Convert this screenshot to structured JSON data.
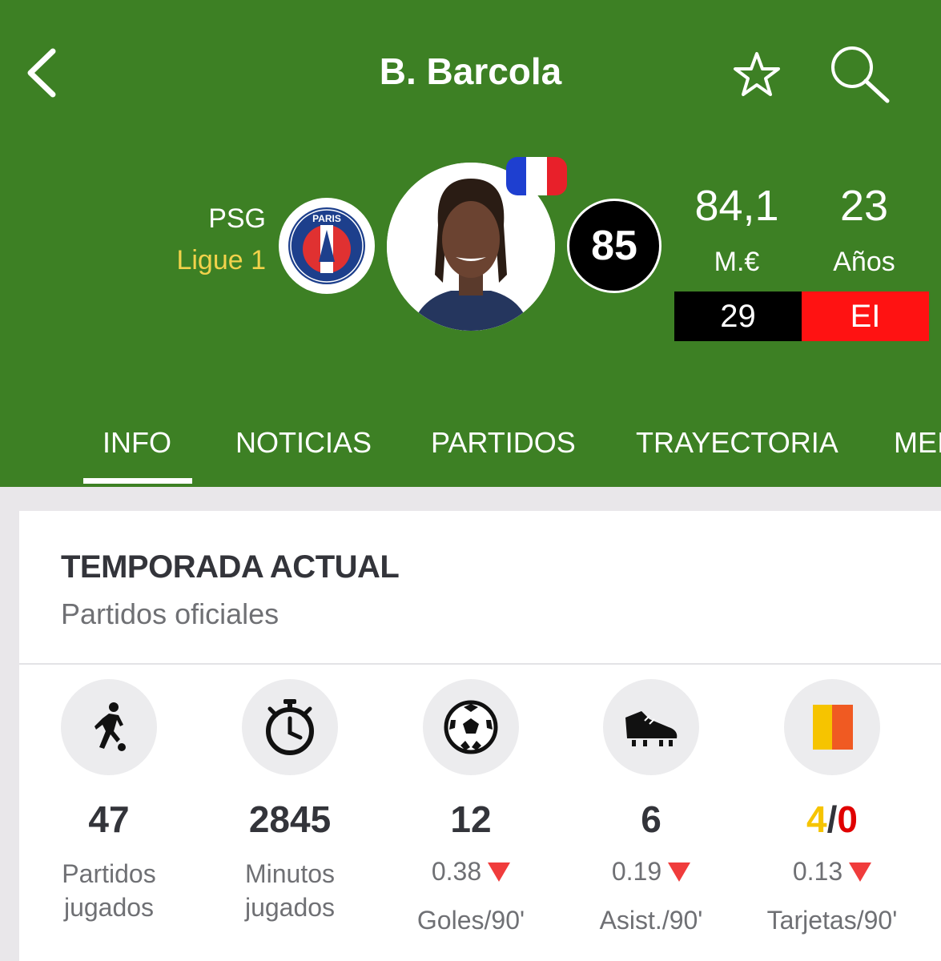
{
  "header": {
    "title": "B. Barcola",
    "back_icon": "chevron-left-icon",
    "favorite_icon": "star-icon",
    "search_icon": "search-icon"
  },
  "player": {
    "team": "PSG",
    "league": "Ligue 1",
    "team_logo_text": "PARIS",
    "nationality_flag": "france-flag",
    "rating": "85",
    "market_value": "84,1",
    "market_value_unit": "M.€",
    "age": "23",
    "age_unit": "Años",
    "shirt_number": "29",
    "position": "EI"
  },
  "tabs": [
    {
      "label": "INFO",
      "active": true
    },
    {
      "label": "NOTICIAS"
    },
    {
      "label": "PARTIDOS"
    },
    {
      "label": "TRAYECTORIA"
    },
    {
      "label": "MEI"
    }
  ],
  "season": {
    "title": "TEMPORADA ACTUAL",
    "subtitle": "Partidos oficiales",
    "stats": [
      {
        "icon": "player-dribbling-icon",
        "value": "47",
        "label_line1": "Partidos",
        "label_line2": "jugados"
      },
      {
        "icon": "stopwatch-icon",
        "value": "2845",
        "label_line1": "Minutos jugados"
      },
      {
        "icon": "soccer-ball-icon",
        "value": "12",
        "ratio": "0.38",
        "label_line1": "Goles/90'"
      },
      {
        "icon": "football-boot-icon",
        "value": "6",
        "ratio": "0.19",
        "label_line1": "Asist./90'"
      },
      {
        "icon": "cards-icon",
        "yellow": "4",
        "separator": "/",
        "red": "0",
        "ratio": "0.13",
        "label_line1": "Tarjetas/90'"
      }
    ]
  },
  "colors": {
    "header_green": "#3d8024",
    "league_yellow": "#f2d24b",
    "position_red": "#ff1212",
    "trend_down_red": "#f03c3c",
    "yellow_card": "#f6c400",
    "red_card": "#e00000"
  }
}
